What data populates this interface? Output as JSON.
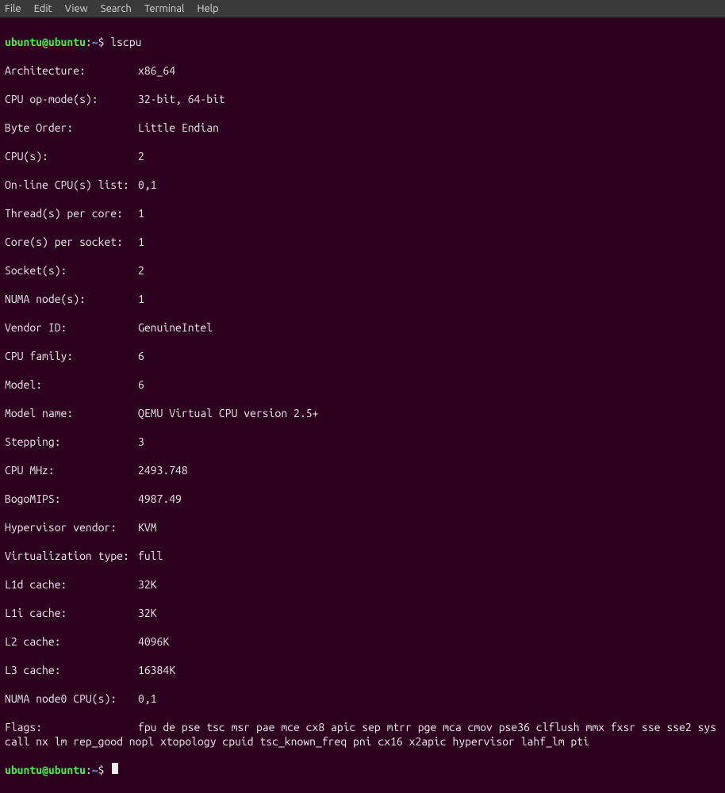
{
  "menubar": {
    "file": "File",
    "edit": "Edit",
    "view": "View",
    "search": "Search",
    "terminal": "Terminal",
    "help": "Help"
  },
  "prompt": {
    "user_host": "ubuntu@ubuntu",
    "colon": ":",
    "path": "~",
    "symbol": "$"
  },
  "command": "lscpu",
  "lscpu": {
    "architecture_k": "Architecture:",
    "architecture_v": "x86_64",
    "op_mode_k": "CPU op-mode(s):",
    "op_mode_v": "32-bit, 64-bit",
    "byte_order_k": "Byte Order:",
    "byte_order_v": "Little Endian",
    "cpus_k": "CPU(s):",
    "cpus_v": "2",
    "online_k": "On-line CPU(s) list:",
    "online_v": "0,1",
    "tpc_k": "Thread(s) per core:",
    "tpc_v": "1",
    "cps_k": "Core(s) per socket:",
    "cps_v": "1",
    "sockets_k": "Socket(s):",
    "sockets_v": "2",
    "numa_k": "NUMA node(s):",
    "numa_v": "1",
    "vendor_k": "Vendor ID:",
    "vendor_v": "GenuineIntel",
    "family_k": "CPU family:",
    "family_v": "6",
    "model_k": "Model:",
    "model_v": "6",
    "modelname_k": "Model name:",
    "modelname_v": "QEMU Virtual CPU version 2.5+",
    "stepping_k": "Stepping:",
    "stepping_v": "3",
    "mhz_k": "CPU MHz:",
    "mhz_v": "2493.748",
    "bogo_k": "BogoMIPS:",
    "bogo_v": "4987.49",
    "hvendor_k": "Hypervisor vendor:",
    "hvendor_v": "KVM",
    "vtype_k": "Virtualization type:",
    "vtype_v": "full",
    "l1d_k": "L1d cache:",
    "l1d_v": "32K",
    "l1i_k": "L1i cache:",
    "l1i_v": "32K",
    "l2_k": "L2 cache:",
    "l2_v": "4096K",
    "l3_k": "L3 cache:",
    "l3_v": "16384K",
    "numan0_k": "NUMA node0 CPU(s):",
    "numan0_v": "0,1",
    "flags_k": "Flags:",
    "flags_v": "fpu de pse tsc msr pae mce cx8 apic sep mtrr pge mca cmov pse36 clflush mmx fxsr sse sse2 syscall nx lm rep_good nopl xtopology cpuid tsc_known_freq pni cx16 x2apic hypervisor lahf_lm pti"
  }
}
